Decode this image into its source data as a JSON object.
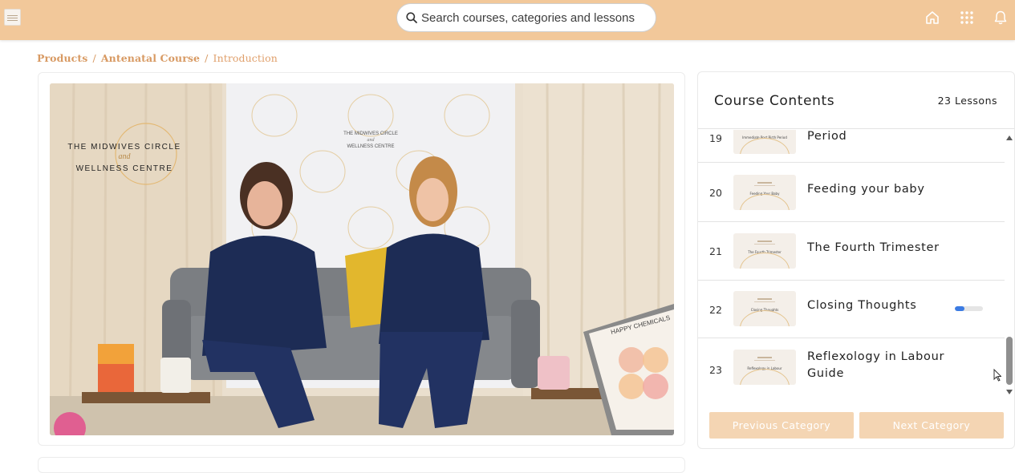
{
  "search": {
    "placeholder": "Search courses, categories and lessons"
  },
  "topbar": {
    "icons": [
      "home-icon",
      "apps-grid-icon",
      "bell-icon"
    ]
  },
  "breadcrumb": {
    "items": [
      "Products",
      "Antenatal Course"
    ],
    "current": "Introduction"
  },
  "video": {
    "backdrop_brand_line1": "THE MIDWIVES CIRCLE",
    "backdrop_brand_line2": "and",
    "backdrop_brand_line3": "WELLNESS CENTRE",
    "overlay_logo_line1": "THE MIDWIVES CIRCLE",
    "overlay_logo_line2": "and",
    "overlay_logo_line3": "WELLNESS CENTRE",
    "poster_title": "HAPPY CHEMICALS"
  },
  "sidebar": {
    "title": "Course Contents",
    "lesson_count": "23 Lessons",
    "lessons": [
      {
        "num": "19",
        "title": "Period",
        "thumb_text": "Immediate Post Birth Period"
      },
      {
        "num": "20",
        "title": "Feeding your baby",
        "thumb_text": "Feeding Your Baby"
      },
      {
        "num": "21",
        "title": "The Fourth Trimester",
        "thumb_text": "The Fourth Trimester"
      },
      {
        "num": "22",
        "title": "Closing Thoughts",
        "thumb_text": "Closing Thoughts",
        "progress": 0.35
      },
      {
        "num": "23",
        "title_line1": "Reflexology in Labour",
        "title_line2": "Guide",
        "thumb_text": "Reflexology in Labour"
      }
    ],
    "prev_label": "Previous Category",
    "next_label": "Next Category"
  },
  "colors": {
    "topbar": "#f2c89a",
    "accent": "#d89a63",
    "button": "#f4d5b3",
    "progress": "#3b7be3"
  }
}
